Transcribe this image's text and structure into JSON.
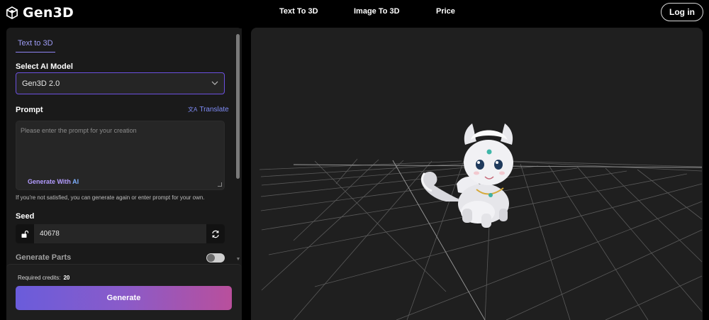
{
  "header": {
    "brand": "Gen3D",
    "nav": [
      "Text To 3D",
      "Image To 3D",
      "Price"
    ],
    "login_label": "Log in"
  },
  "panel": {
    "tab_label": "Text to 3D",
    "model": {
      "label": "Select AI Model",
      "selected": "Gen3D 2.0"
    },
    "prompt": {
      "label": "Prompt",
      "translate_label": "Translate",
      "placeholder": "Please enter the prompt for your creation",
      "generate_ai_prefix": "Generate With ",
      "generate_ai_suffix": "AI",
      "hint": "If you're not satisfied, you can generate again or enter prompt for your own."
    },
    "seed": {
      "label": "Seed",
      "value": "40678"
    },
    "parts": {
      "label": "Generate Parts",
      "enabled": false
    },
    "credits_label": "Required credits:",
    "credits_value": "20",
    "generate_label": "Generate"
  },
  "colors": {
    "accent": "#8f84f5",
    "generate_gradient_start": "#6a5cdb",
    "generate_gradient_end": "#b94f9c"
  }
}
